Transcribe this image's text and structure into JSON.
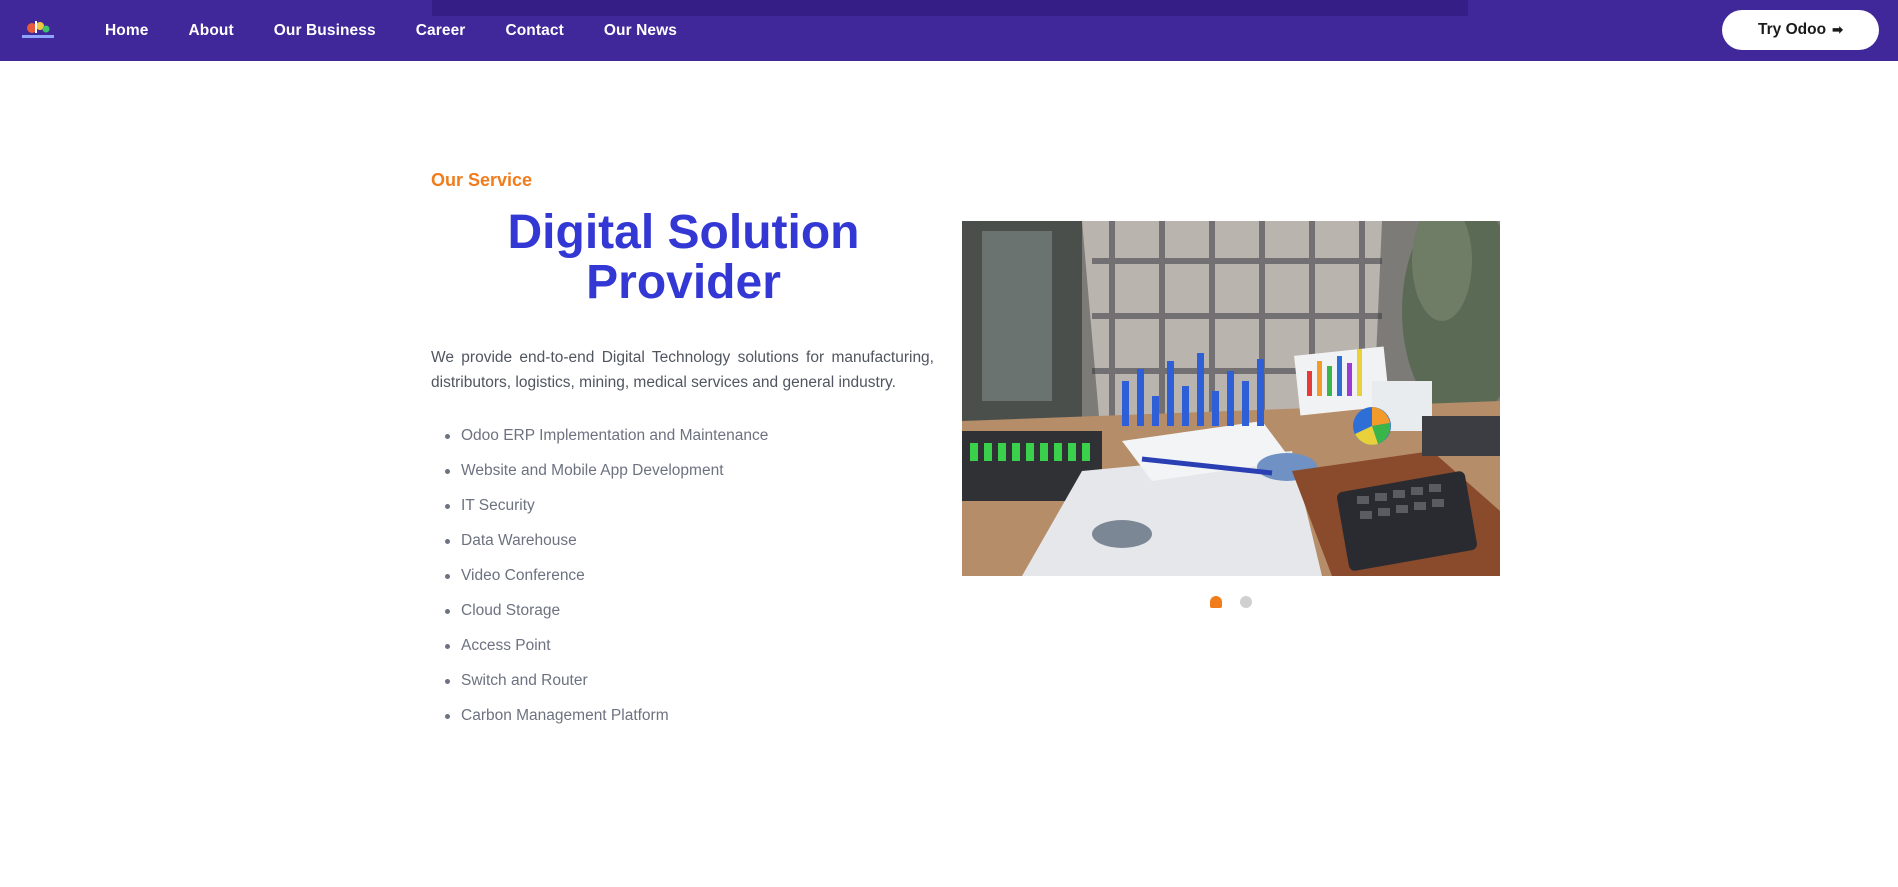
{
  "nav": {
    "links": [
      "Home",
      "About",
      "Our Business",
      "Career",
      "Contact",
      "Our News"
    ],
    "cta_label": "Try Odoo",
    "cta_icon": "arrow-right-icon"
  },
  "section": {
    "eyebrow": "Our Service",
    "heading": "Digital Solution Provider",
    "intro": "We provide end-to-end Digital Technology solutions for manufacturing, distributors, logistics, mining, medical services and general industry.",
    "services": [
      "Odoo ERP Implementation and Maintenance",
      "Website and Mobile App Development",
      "IT Security",
      "Data Warehouse",
      "Video Conference",
      "Cloud Storage",
      "Access Point",
      "Switch and Router",
      "Carbon Management Platform"
    ]
  },
  "carousel": {
    "slide_count": 2,
    "active_index": 0
  },
  "colors": {
    "nav_bg": "#40279a",
    "accent_orange": "#f07c1c",
    "heading_blue": "#3338d4"
  }
}
